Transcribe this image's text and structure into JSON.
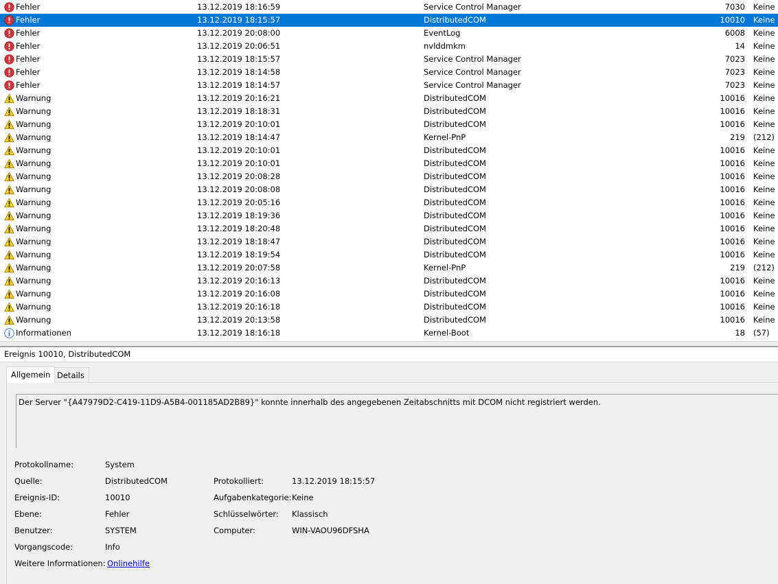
{
  "events": [
    {
      "level": "Fehler",
      "type": "error",
      "date": "13.12.2019 18:16:59",
      "source": "Service Control Manager",
      "id": "7030",
      "task": "Keine"
    },
    {
      "level": "Fehler",
      "type": "error",
      "date": "13.12.2019 18:15:57",
      "source": "DistributedCOM",
      "id": "10010",
      "task": "Keine",
      "selected": true
    },
    {
      "level": "Fehler",
      "type": "error",
      "date": "13.12.2019 20:08:00",
      "source": "EventLog",
      "id": "6008",
      "task": "Keine"
    },
    {
      "level": "Fehler",
      "type": "error",
      "date": "13.12.2019 20:06:51",
      "source": "nvlddmkm",
      "id": "14",
      "task": "Keine"
    },
    {
      "level": "Fehler",
      "type": "error",
      "date": "13.12.2019 18:15:57",
      "source": "Service Control Manager",
      "id": "7023",
      "task": "Keine"
    },
    {
      "level": "Fehler",
      "type": "error",
      "date": "13.12.2019 18:14:58",
      "source": "Service Control Manager",
      "id": "7023",
      "task": "Keine"
    },
    {
      "level": "Fehler",
      "type": "error",
      "date": "13.12.2019 18:14:57",
      "source": "Service Control Manager",
      "id": "7023",
      "task": "Keine"
    },
    {
      "level": "Warnung",
      "type": "warning",
      "date": "13.12.2019 20:16:21",
      "source": "DistributedCOM",
      "id": "10016",
      "task": "Keine"
    },
    {
      "level": "Warnung",
      "type": "warning",
      "date": "13.12.2019 18:18:31",
      "source": "DistributedCOM",
      "id": "10016",
      "task": "Keine"
    },
    {
      "level": "Warnung",
      "type": "warning",
      "date": "13.12.2019 20:10:01",
      "source": "DistributedCOM",
      "id": "10016",
      "task": "Keine"
    },
    {
      "level": "Warnung",
      "type": "warning",
      "date": "13.12.2019 18:14:47",
      "source": "Kernel-PnP",
      "id": "219",
      "task": "(212)"
    },
    {
      "level": "Warnung",
      "type": "warning",
      "date": "13.12.2019 20:10:01",
      "source": "DistributedCOM",
      "id": "10016",
      "task": "Keine"
    },
    {
      "level": "Warnung",
      "type": "warning",
      "date": "13.12.2019 20:10:01",
      "source": "DistributedCOM",
      "id": "10016",
      "task": "Keine"
    },
    {
      "level": "Warnung",
      "type": "warning",
      "date": "13.12.2019 20:08:28",
      "source": "DistributedCOM",
      "id": "10016",
      "task": "Keine"
    },
    {
      "level": "Warnung",
      "type": "warning",
      "date": "13.12.2019 20:08:08",
      "source": "DistributedCOM",
      "id": "10016",
      "task": "Keine"
    },
    {
      "level": "Warnung",
      "type": "warning",
      "date": "13.12.2019 20:05:16",
      "source": "DistributedCOM",
      "id": "10016",
      "task": "Keine"
    },
    {
      "level": "Warnung",
      "type": "warning",
      "date": "13.12.2019 18:19:36",
      "source": "DistributedCOM",
      "id": "10016",
      "task": "Keine"
    },
    {
      "level": "Warnung",
      "type": "warning",
      "date": "13.12.2019 18:20:48",
      "source": "DistributedCOM",
      "id": "10016",
      "task": "Keine"
    },
    {
      "level": "Warnung",
      "type": "warning",
      "date": "13.12.2019 18:18:47",
      "source": "DistributedCOM",
      "id": "10016",
      "task": "Keine"
    },
    {
      "level": "Warnung",
      "type": "warning",
      "date": "13.12.2019 18:19:54",
      "source": "DistributedCOM",
      "id": "10016",
      "task": "Keine"
    },
    {
      "level": "Warnung",
      "type": "warning",
      "date": "13.12.2019 20:07:58",
      "source": "Kernel-PnP",
      "id": "219",
      "task": "(212)"
    },
    {
      "level": "Warnung",
      "type": "warning",
      "date": "13.12.2019 20:16:13",
      "source": "DistributedCOM",
      "id": "10016",
      "task": "Keine"
    },
    {
      "level": "Warnung",
      "type": "warning",
      "date": "13.12.2019 20:16:08",
      "source": "DistributedCOM",
      "id": "10016",
      "task": "Keine"
    },
    {
      "level": "Warnung",
      "type": "warning",
      "date": "13.12.2019 20:16:18",
      "source": "DistributedCOM",
      "id": "10016",
      "task": "Keine"
    },
    {
      "level": "Warnung",
      "type": "warning",
      "date": "13.12.2019 20:13:58",
      "source": "DistributedCOM",
      "id": "10016",
      "task": "Keine"
    },
    {
      "level": "Informationen",
      "type": "info",
      "date": "13.12.2019 18:16:18",
      "source": "Kernel-Boot",
      "id": "18",
      "task": "(57)"
    }
  ],
  "detail": {
    "header": "Ereignis 10010, DistributedCOM",
    "tabs": [
      "Allgemein",
      "Details"
    ],
    "message": "Der Server \"{A47979D2-C419-11D9-A5B4-001185AD2B89}\" konnte innerhalb des angegebenen Zeitabschnitts mit DCOM nicht registriert werden.",
    "props": {
      "protokollname_label": "Protokollname:",
      "protokollname": "System",
      "quelle_label": "Quelle:",
      "quelle": "DistributedCOM",
      "protokolliert_label": "Protokolliert:",
      "protokolliert": "13.12.2019 18:15:57",
      "ereignis_id_label": "Ereignis-ID:",
      "ereignis_id": "10010",
      "aufgabenkategorie_label": "Aufgabenkategorie:",
      "aufgabenkategorie": "Keine",
      "ebene_label": "Ebene:",
      "ebene": "Fehler",
      "schluesselwoerter_label": "Schlüsselwörter:",
      "schluesselwoerter": "Klassisch",
      "benutzer_label": "Benutzer:",
      "benutzer": "SYSTEM",
      "computer_label": "Computer:",
      "computer": "WIN-VAOU96DFSHA",
      "vorgangscode_label": "Vorgangscode:",
      "vorgangscode": "Info",
      "weitere_label": "Weitere Informationen:",
      "weitere_link": "Onlinehilfe"
    }
  },
  "colors": {
    "selection": "#0078d7",
    "error": "#d13438",
    "warning": "#fcd116",
    "info": "#3a6fb5",
    "link": "#0000ee"
  }
}
